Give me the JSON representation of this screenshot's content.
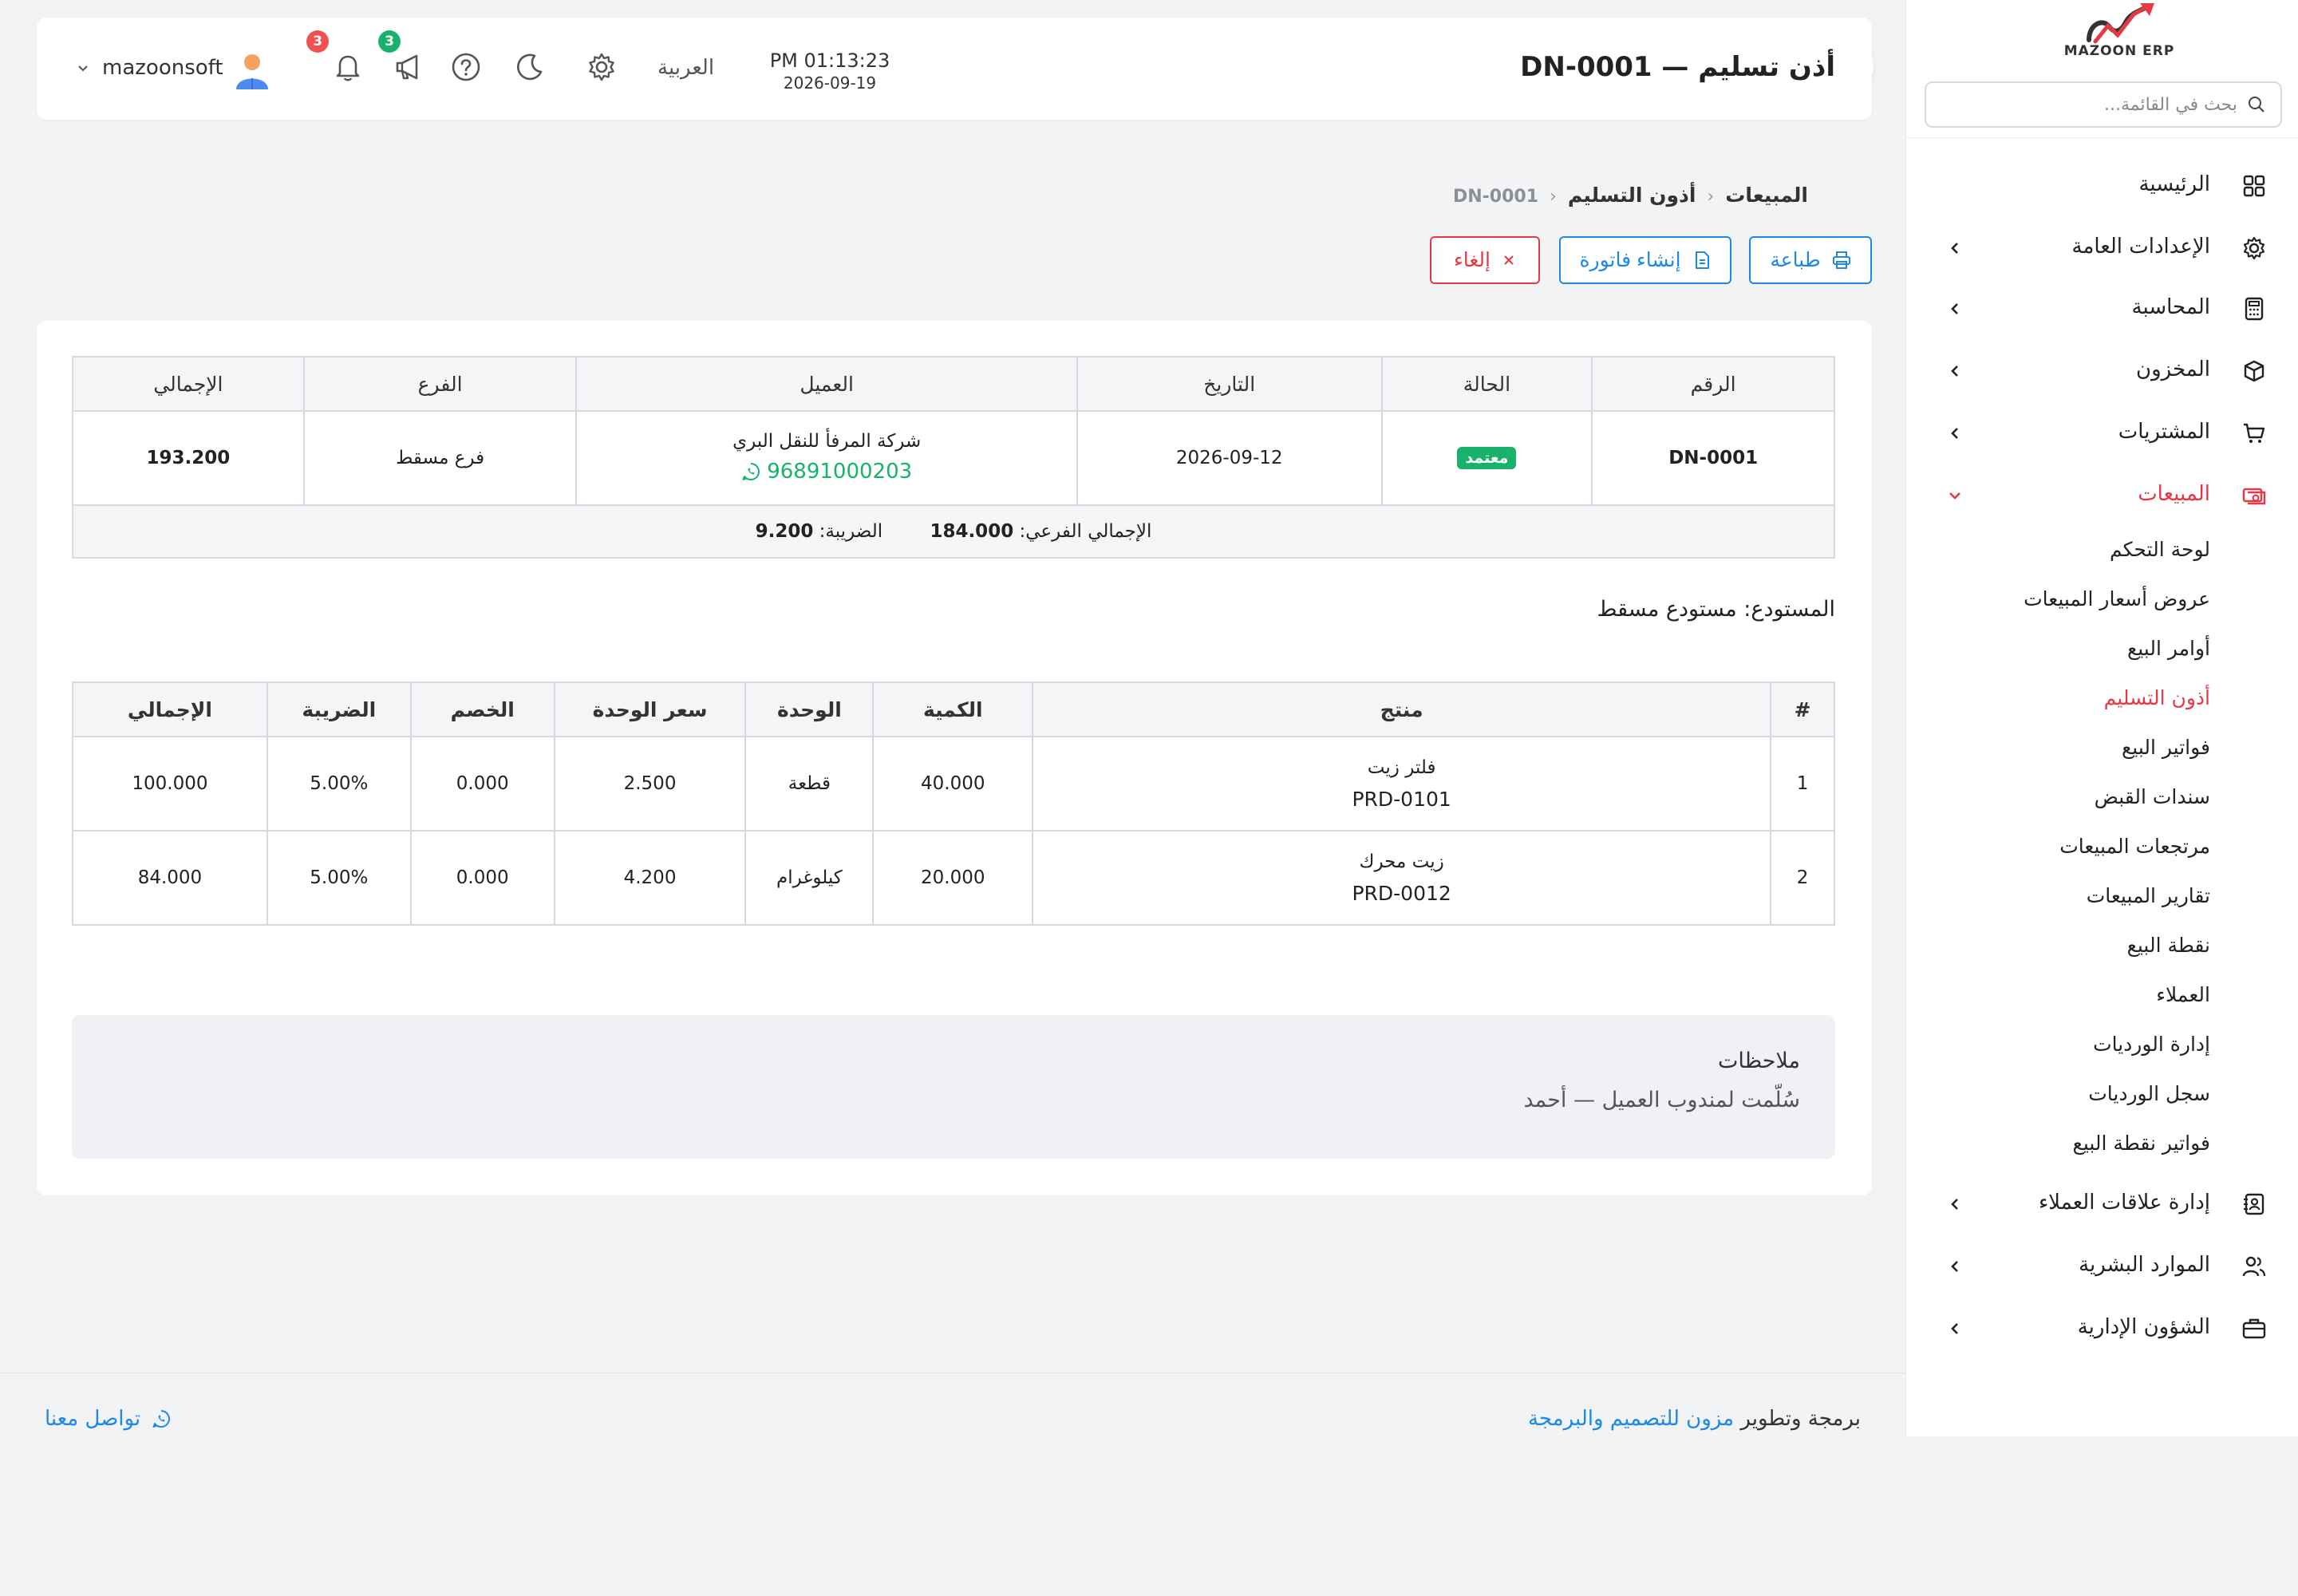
{
  "app": {
    "logo_text": "MAZOON ERP",
    "page_title": "أذن تسليم — DN-0001"
  },
  "header": {
    "time": "PM 01:13:23",
    "date": "2026-09-19",
    "language": "العربية",
    "notifications_count": "3",
    "announcements_count": "3",
    "username": "mazoonsoft",
    "icons": [
      "settings-icon",
      "dark-mode-icon",
      "help-icon",
      "megaphone-icon",
      "bell-icon",
      "avatar"
    ]
  },
  "sidebar": {
    "search_placeholder": "بحث في القائمة...",
    "items": [
      {
        "label": "الرئيسية",
        "icon": "dashboard-grid-icon"
      },
      {
        "label": "الإعدادات العامة",
        "icon": "gear-icon"
      },
      {
        "label": "المحاسبة",
        "icon": "calculator-icon"
      },
      {
        "label": "المخزون",
        "icon": "box-icon"
      },
      {
        "label": "المشتريات",
        "icon": "cart-icon"
      },
      {
        "label": "المبيعات",
        "icon": "cash-icon"
      },
      {
        "label": "إدارة علاقات العملاء",
        "icon": "contacts-book-icon"
      },
      {
        "label": "الموارد البشرية",
        "icon": "users-icon"
      },
      {
        "label": "الشؤون الإدارية",
        "icon": "briefcase-icon"
      }
    ],
    "sales_sub": [
      "لوحة التحكم",
      "عروض أسعار المبيعات",
      "أوامر البيع",
      "أذون التسليم",
      "فواتير البيع",
      "سندات القبض",
      "مرتجعات المبيعات",
      "تقارير المبيعات",
      "نقطة البيع",
      "العملاء",
      "إدارة الورديات",
      "سجل الورديات",
      "فواتير نقطة البيع"
    ]
  },
  "breadcrumb": {
    "level1": "المبيعات",
    "level2": "أذون التسليم",
    "level3": "DN-0001"
  },
  "actions": {
    "print": "طباعة",
    "create_invoice": "إنشاء فاتورة",
    "cancel": "إلغاء"
  },
  "summary": {
    "headers": {
      "number": "الرقم",
      "status": "الحالة",
      "date": "التاريخ",
      "customer": "العميل",
      "branch": "الفرع",
      "total": "الإجمالي"
    },
    "number": "DN-0001",
    "status": "معتمد",
    "date": "2026-09-12",
    "customer_name": "شركة المرفأ للنقل البري",
    "customer_phone": "96891000203",
    "branch": "فرع مسقط",
    "total": "193.200",
    "subtotal_label": "الإجمالي الفرعي:",
    "subtotal": "184.000",
    "tax_label": "الضريبة:",
    "tax": "9.200"
  },
  "warehouse": "المستودع: مستودع مسقط",
  "items": {
    "headers": {
      "index": "#",
      "product": "منتج",
      "qty": "الكمية",
      "unit": "الوحدة",
      "unit_price": "سعر الوحدة",
      "discount": "الخصم",
      "tax": "الضريبة",
      "total": "الإجمالي"
    },
    "rows": [
      {
        "index": "1",
        "name": "فلتر زيت",
        "code": "PRD-0101",
        "qty": "40.000",
        "unit": "قطعة",
        "unit_price": "2.500",
        "discount": "0.000",
        "tax": "5.00%",
        "total": "100.000"
      },
      {
        "index": "2",
        "name": "زيت محرك",
        "code": "PRD-0012",
        "qty": "20.000",
        "unit": "كيلوغرام",
        "unit_price": "4.200",
        "discount": "0.000",
        "tax": "5.00%",
        "total": "84.000"
      }
    ]
  },
  "notes": {
    "title": "ملاحظات",
    "body": "سُلّمت لمندوب العميل — أحمد"
  },
  "footer": {
    "credit_prefix": "برمجة وتطوير",
    "credit_link": "مزون للتصميم والبرمجة",
    "contact": "تواصل معنا"
  },
  "colors": {
    "accent_blue": "#1e88e5",
    "danger_red": "#e53946",
    "success_green": "#18b26b"
  }
}
